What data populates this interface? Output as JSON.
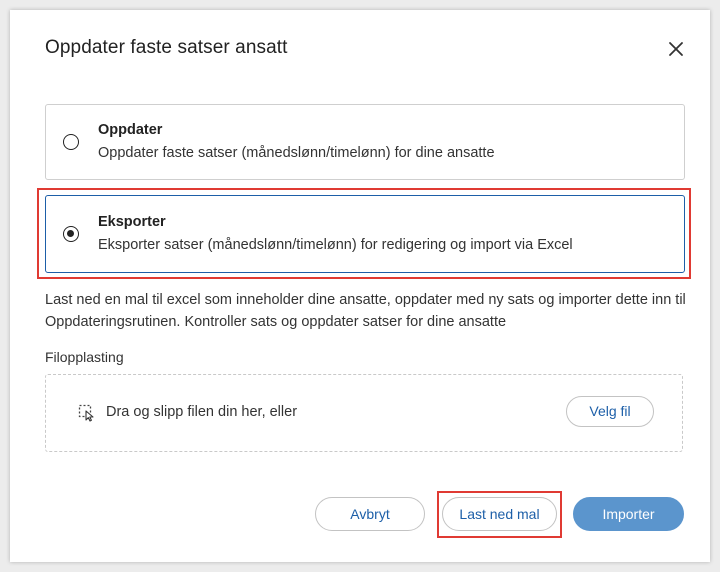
{
  "dialog": {
    "title": "Oppdater faste satser ansatt"
  },
  "options": [
    {
      "title": "Oppdater",
      "description": "Oppdater faste satser (månedslønn/timelønn) for dine ansatte",
      "selected": false
    },
    {
      "title": "Eksporter",
      "description": "Eksporter satser (månedslønn/timelønn) for redigering og import via Excel",
      "selected": true
    }
  ],
  "info_text": "Last ned en mal til excel som inneholder dine ansatte, oppdater med ny sats og importer dette inn til Oppdateringsrutinen. Kontroller sats og oppdater satser for dine ansatte",
  "upload": {
    "label": "Filopplasting",
    "dropzone_text": "Dra og slipp filen din her, eller",
    "choose_file_label": "Velg fil"
  },
  "footer": {
    "cancel_label": "Avbryt",
    "download_template_label": "Last ned mal",
    "import_label": "Importer"
  },
  "colors": {
    "accent": "#1d5fa8",
    "primary_button": "#5b95cd",
    "highlight": "#e03a33"
  },
  "icons": {
    "close": "close-icon",
    "upload": "drag-drop-icon"
  }
}
